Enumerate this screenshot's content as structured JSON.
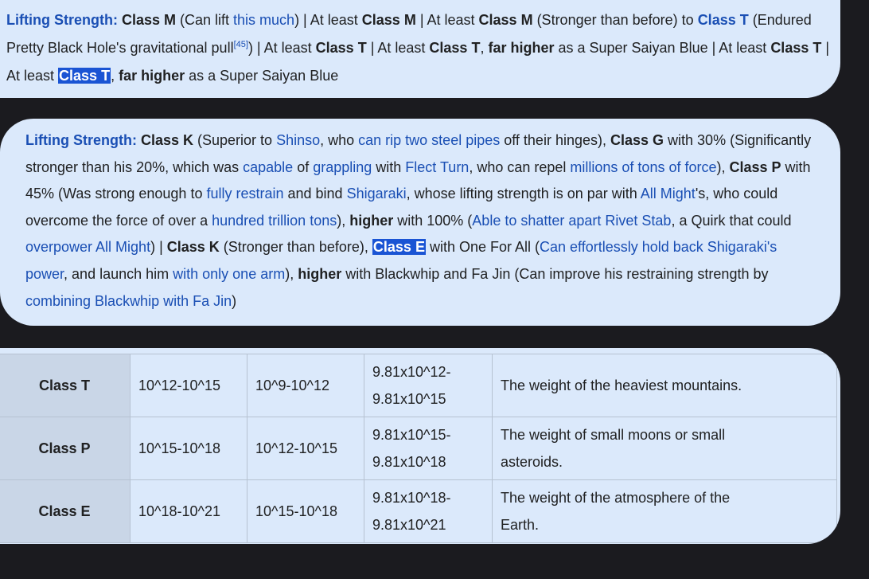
{
  "card1": {
    "label": "Lifting Strength:",
    "p1": " Class M",
    "t1": " (Can lift ",
    "l1": "this much",
    "t2": ") | At least ",
    "p2": "Class M",
    "t3": " | At least ",
    "p3": "Class M",
    "t4": " (Stronger than before) to ",
    "p4": "Class T",
    "t5": " (Endured Pretty Black Hole's gravitational pull",
    "ref": "[45]",
    "t6": ") | At least ",
    "p5": "Class T",
    "t7": " | At least ",
    "p6": "Class T",
    "t8": ", ",
    "p7": "far higher",
    "t9": " as a Super Saiyan Blue | At least ",
    "p8": "Class T",
    "t10": " | At least ",
    "p9": "Class T",
    "t11": ", ",
    "p10": "far higher",
    "t12": " as a Super Saiyan Blue"
  },
  "card2": {
    "label": "Lifting Strength:",
    "p1": " Class K",
    "t1": " (Superior to ",
    "l1": "Shinso",
    "t2": ", who ",
    "l2": "can rip two steel pipes",
    "t3": " off their hinges), ",
    "p2": "Class G",
    "t4": " with 30% (Significantly stronger than his 20%, which was ",
    "l3": "capable",
    "t5": " of ",
    "l4": "grappling",
    "t6": " with ",
    "l5": "Flect Turn",
    "t7": ", who can repel ",
    "l6": "millions of tons of force",
    "t8": "), ",
    "p3": "Class P",
    "t9": " with 45% (Was strong enough to ",
    "l7": "fully restrain",
    "t10": " and bind ",
    "l8": "Shigaraki",
    "t11": ", whose lifting strength is on par with ",
    "l9": "All Might",
    "t12": "'s, who could overcome the force of over a ",
    "l10": "hundred trillion tons",
    "t13": "), ",
    "p4": "higher",
    "t14": " with 100% (",
    "l11": "Able to shatter apart Rivet Stab",
    "t15": ", a Quirk that could ",
    "l12": "overpower All Might",
    "t16": ") | ",
    "p5": "Class K",
    "t17": " (Stronger than before), ",
    "p6": "Class E",
    "t18": " with One For All (",
    "l13": "Can effortlessly hold back Shigaraki's power",
    "t19": ", and launch him ",
    "l14": "with only one arm",
    "t20": "), ",
    "p7": "higher",
    "t21": " with Blackwhip and Fa Jin (Can improve his restraining strength by ",
    "l15": "combining Blackwhip with Fa Jin",
    "t22": ")"
  },
  "table": {
    "rows": [
      {
        "cls": "Class T",
        "c2": "10^12-10^15",
        "c3": "10^9-10^12",
        "c4a": "9.81x10^12-",
        "c4b": "9.81x10^15",
        "c5a": "The weight of the heaviest mountains.",
        "c5b": ""
      },
      {
        "cls": "Class P",
        "c2": "10^15-10^18",
        "c3": "10^12-10^15",
        "c4a": "9.81x10^15-",
        "c4b": "9.81x10^18",
        "c5a": "The weight of small moons or small",
        "c5b": "asteroids."
      },
      {
        "cls": "Class E",
        "c2": "10^18-10^21",
        "c3": "10^15-10^18",
        "c4a": "9.81x10^18-",
        "c4b": "9.81x10^21",
        "c5a": "The weight of the atmosphere of the",
        "c5b": "Earth."
      }
    ]
  },
  "colors": {
    "background": "#1b1b1f",
    "card": "#dbe9fb",
    "link": "#1a4fb4",
    "highlight": "#1a54d4",
    "header_cell": "#c9d6e7"
  }
}
